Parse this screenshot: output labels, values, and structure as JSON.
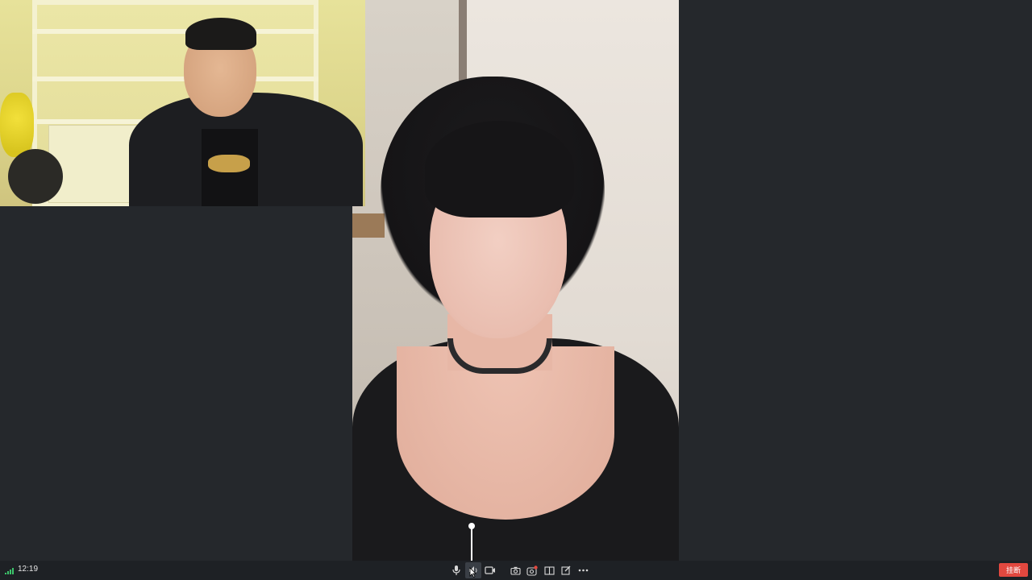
{
  "status_bar": {
    "time": "12:19"
  },
  "toolbar": {
    "buttons": [
      {
        "icon": "microphone-icon"
      },
      {
        "icon": "speaker-icon"
      },
      {
        "icon": "video-camera-icon"
      },
      {
        "icon": "screenshot-camera-icon"
      },
      {
        "icon": "record-icon"
      },
      {
        "icon": "layout-icon"
      },
      {
        "icon": "edit-icon"
      },
      {
        "icon": "more-icon"
      }
    ],
    "hangup_label": "挂断"
  },
  "colors": {
    "hangup": "#e2483f",
    "signal": "#3cc46a",
    "background": "#25282c",
    "toolbar": "#1e2125"
  }
}
